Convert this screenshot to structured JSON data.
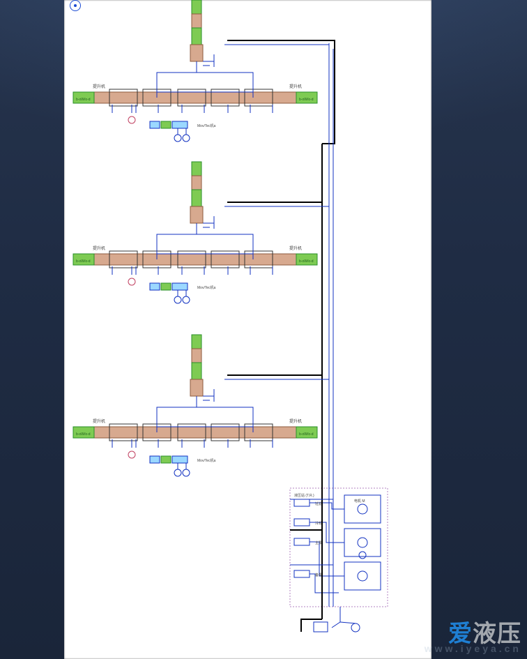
{
  "domain": "Diagram",
  "watermark": {
    "cn_accent": "爱",
    "cn_rest": "液压",
    "url": "www.iyeya.cn"
  },
  "icons": {
    "location": "location-icon"
  },
  "units": [
    {
      "label": "提升机",
      "sublabel": "MovTec机"
    },
    {
      "label": "提升机",
      "sublabel": "MovTec机"
    },
    {
      "label": "提升机",
      "sublabel": "MovTec机"
    }
  ],
  "power_block": {
    "labels": [
      "液压站",
      "电机",
      "泵",
      "过滤器",
      "冷却器"
    ]
  }
}
